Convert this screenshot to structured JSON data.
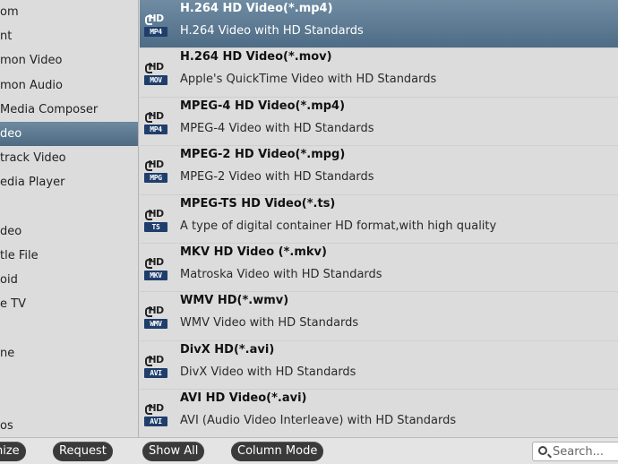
{
  "categories": [
    {
      "label": "om",
      "selected": false
    },
    {
      "label": "nt",
      "selected": false
    },
    {
      "label": "mon Video",
      "selected": false
    },
    {
      "label": "mon Audio",
      "selected": false
    },
    {
      "label": "Media Composer",
      "selected": false
    },
    {
      "label": "deo",
      "selected": true
    },
    {
      "label": "track Video",
      "selected": false
    },
    {
      "label": "edia Player",
      "selected": false
    },
    {
      "label": "",
      "selected": false
    },
    {
      "label": "deo",
      "selected": false
    },
    {
      "label": "tle File",
      "selected": false
    },
    {
      "label": "oid",
      "selected": false
    },
    {
      "label": "e TV",
      "selected": false
    },
    {
      "label": "",
      "selected": false
    },
    {
      "label": "ne",
      "selected": false
    },
    {
      "label": "",
      "selected": false
    },
    {
      "label": "",
      "selected": false
    },
    {
      "label": "os",
      "selected": false
    }
  ],
  "formats": [
    {
      "title": "H.264 HD Video(*.mp4)",
      "desc": "H.264 Video with HD Standards",
      "hd": "HD",
      "ext": "MP4",
      "selected": true
    },
    {
      "title": "H.264 HD Video(*.mov)",
      "desc": "Apple's QuickTime Video with HD Standards",
      "hd": "HD",
      "ext": "MOV",
      "selected": false
    },
    {
      "title": "MPEG-4 HD Video(*.mp4)",
      "desc": "MPEG-4 Video with HD Standards",
      "hd": "HD",
      "ext": "MP4",
      "selected": false
    },
    {
      "title": "MPEG-2 HD Video(*.mpg)",
      "desc": "MPEG-2 Video with HD Standards",
      "hd": "HD",
      "ext": "MPG",
      "selected": false
    },
    {
      "title": "MPEG-TS HD Video(*.ts)",
      "desc": "A type of digital container HD format,with high quality",
      "hd": "HD",
      "ext": "TS",
      "selected": false
    },
    {
      "title": "MKV HD Video (*.mkv)",
      "desc": "Matroska Video with HD Standards",
      "hd": "HD",
      "ext": "MKV",
      "selected": false
    },
    {
      "title": "WMV HD(*.wmv)",
      "desc": "WMV Video with HD Standards",
      "hd": "HD",
      "ext": "WMV",
      "selected": false
    },
    {
      "title": "DivX HD(*.avi)",
      "desc": "DivX Video with HD Standards",
      "hd": "HD",
      "ext": "AVI",
      "selected": false
    },
    {
      "title": "AVI HD Video(*.avi)",
      "desc": "AVI (Audio Video Interleave) with HD Standards",
      "hd": "HD",
      "ext": "AVI",
      "selected": false
    }
  ],
  "toolbar": {
    "customize_label": "nize",
    "request_label": "Request",
    "show_all_label": "Show All",
    "column_mode_label": "Column Mode",
    "search_placeholder": "Search..."
  },
  "colors": {
    "selection": "#4e6c85",
    "badge": "#1f3e6b",
    "button": "#3a3a3a"
  }
}
